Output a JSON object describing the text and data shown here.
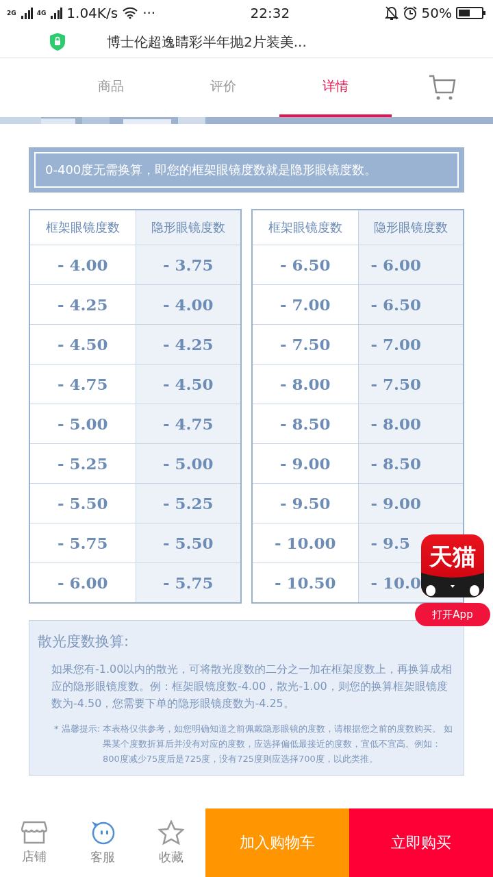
{
  "status_bar": {
    "networks": [
      "2G",
      "4G"
    ],
    "speed": "1.04K/s",
    "more": "···",
    "time": "22:32",
    "battery": "50%"
  },
  "address_bar": {
    "title": "博士伦超逸睛彩半年抛2片装美..."
  },
  "tabs": [
    {
      "label": "商品",
      "selected": false
    },
    {
      "label": "评价",
      "selected": false
    },
    {
      "label": "详情",
      "selected": true
    }
  ],
  "notice": "0-400度无需换算，即您的框架眼镜度数就是隐形眼镜度数。",
  "tables": [
    {
      "columns": [
        "框架眼镜度数",
        "隐形眼镜度数"
      ],
      "rows": [
        [
          "- 4.00",
          "- 3.75"
        ],
        [
          "- 4.25",
          "- 4.00"
        ],
        [
          "- 4.50",
          "- 4.25"
        ],
        [
          "- 4.75",
          "- 4.50"
        ],
        [
          "- 5.00",
          "- 4.75"
        ],
        [
          "- 5.25",
          "- 5.00"
        ],
        [
          "- 5.50",
          "- 5.25"
        ],
        [
          "- 5.75",
          "- 5.50"
        ],
        [
          "- 6.00",
          "- 5.75"
        ]
      ]
    },
    {
      "columns": [
        "框架眼镜度数",
        "隐形眼镜度数"
      ],
      "rows": [
        [
          "- 6.50",
          "- 6.00"
        ],
        [
          "- 7.00",
          "- 6.50"
        ],
        [
          "- 7.50",
          "- 7.00"
        ],
        [
          "- 8.00",
          "- 7.50"
        ],
        [
          "- 8.50",
          "- 8.00"
        ],
        [
          "- 9.00",
          "- 8.50"
        ],
        [
          "- 9.50",
          "- 9.00"
        ],
        [
          "- 10.00",
          "- 9.5"
        ],
        [
          "- 10.50",
          "- 10.0"
        ]
      ]
    }
  ],
  "astigmatism": {
    "title": "散光度数换算:",
    "body": "如果您有-1.00以内的散光，可将散光度数的二分之一加在框架度数上，再换算成相应的隐形眼镜度数。例：框架眼镜度数-4.00，散光-1.00，则您的换算框架眼镜度数为-4.50，您需要下单的隐形眼镜度数为-4.25。",
    "tip_label": "* 温馨提示:",
    "tip": "本表格仅供参考，如您明确知道之前佩戴隐形眼镜的度数，请根据您之前的度数购买。 如果某个度数折算后并没有对应的度数，应选择偏低最接近的度数，宜低不宜高。例如：800度减少75度后是725度，没有725度则应选择700度，以此类推。"
  },
  "app_badge": {
    "logo": "天猫",
    "button": "打开App"
  },
  "bottom_bar": {
    "icons": [
      {
        "kind": "shop",
        "label": "店铺"
      },
      {
        "kind": "chat",
        "label": "客服"
      },
      {
        "kind": "star",
        "label": "收藏"
      }
    ],
    "buttons": [
      {
        "kind": "cart",
        "label": "加入购物车"
      },
      {
        "kind": "buy",
        "label": "立即购买"
      }
    ]
  }
}
